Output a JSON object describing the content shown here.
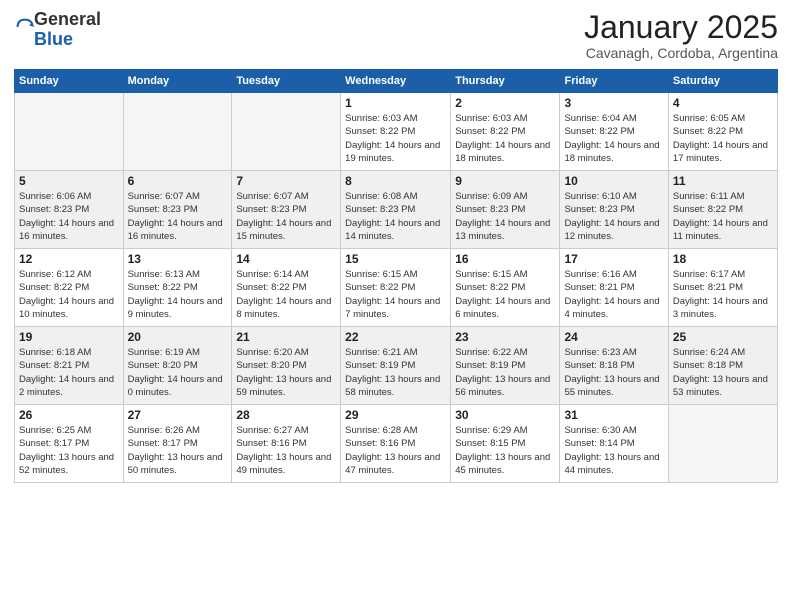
{
  "logo": {
    "general": "General",
    "blue": "Blue"
  },
  "title": "January 2025",
  "location": "Cavanagh, Cordoba, Argentina",
  "weekdays": [
    "Sunday",
    "Monday",
    "Tuesday",
    "Wednesday",
    "Thursday",
    "Friday",
    "Saturday"
  ],
  "weeks": [
    [
      {
        "day": "",
        "info": ""
      },
      {
        "day": "",
        "info": ""
      },
      {
        "day": "",
        "info": ""
      },
      {
        "day": "1",
        "info": "Sunrise: 6:03 AM\nSunset: 8:22 PM\nDaylight: 14 hours and 19 minutes."
      },
      {
        "day": "2",
        "info": "Sunrise: 6:03 AM\nSunset: 8:22 PM\nDaylight: 14 hours and 18 minutes."
      },
      {
        "day": "3",
        "info": "Sunrise: 6:04 AM\nSunset: 8:22 PM\nDaylight: 14 hours and 18 minutes."
      },
      {
        "day": "4",
        "info": "Sunrise: 6:05 AM\nSunset: 8:22 PM\nDaylight: 14 hours and 17 minutes."
      }
    ],
    [
      {
        "day": "5",
        "info": "Sunrise: 6:06 AM\nSunset: 8:23 PM\nDaylight: 14 hours and 16 minutes."
      },
      {
        "day": "6",
        "info": "Sunrise: 6:07 AM\nSunset: 8:23 PM\nDaylight: 14 hours and 16 minutes."
      },
      {
        "day": "7",
        "info": "Sunrise: 6:07 AM\nSunset: 8:23 PM\nDaylight: 14 hours and 15 minutes."
      },
      {
        "day": "8",
        "info": "Sunrise: 6:08 AM\nSunset: 8:23 PM\nDaylight: 14 hours and 14 minutes."
      },
      {
        "day": "9",
        "info": "Sunrise: 6:09 AM\nSunset: 8:23 PM\nDaylight: 14 hours and 13 minutes."
      },
      {
        "day": "10",
        "info": "Sunrise: 6:10 AM\nSunset: 8:23 PM\nDaylight: 14 hours and 12 minutes."
      },
      {
        "day": "11",
        "info": "Sunrise: 6:11 AM\nSunset: 8:22 PM\nDaylight: 14 hours and 11 minutes."
      }
    ],
    [
      {
        "day": "12",
        "info": "Sunrise: 6:12 AM\nSunset: 8:22 PM\nDaylight: 14 hours and 10 minutes."
      },
      {
        "day": "13",
        "info": "Sunrise: 6:13 AM\nSunset: 8:22 PM\nDaylight: 14 hours and 9 minutes."
      },
      {
        "day": "14",
        "info": "Sunrise: 6:14 AM\nSunset: 8:22 PM\nDaylight: 14 hours and 8 minutes."
      },
      {
        "day": "15",
        "info": "Sunrise: 6:15 AM\nSunset: 8:22 PM\nDaylight: 14 hours and 7 minutes."
      },
      {
        "day": "16",
        "info": "Sunrise: 6:15 AM\nSunset: 8:22 PM\nDaylight: 14 hours and 6 minutes."
      },
      {
        "day": "17",
        "info": "Sunrise: 6:16 AM\nSunset: 8:21 PM\nDaylight: 14 hours and 4 minutes."
      },
      {
        "day": "18",
        "info": "Sunrise: 6:17 AM\nSunset: 8:21 PM\nDaylight: 14 hours and 3 minutes."
      }
    ],
    [
      {
        "day": "19",
        "info": "Sunrise: 6:18 AM\nSunset: 8:21 PM\nDaylight: 14 hours and 2 minutes."
      },
      {
        "day": "20",
        "info": "Sunrise: 6:19 AM\nSunset: 8:20 PM\nDaylight: 14 hours and 0 minutes."
      },
      {
        "day": "21",
        "info": "Sunrise: 6:20 AM\nSunset: 8:20 PM\nDaylight: 13 hours and 59 minutes."
      },
      {
        "day": "22",
        "info": "Sunrise: 6:21 AM\nSunset: 8:19 PM\nDaylight: 13 hours and 58 minutes."
      },
      {
        "day": "23",
        "info": "Sunrise: 6:22 AM\nSunset: 8:19 PM\nDaylight: 13 hours and 56 minutes."
      },
      {
        "day": "24",
        "info": "Sunrise: 6:23 AM\nSunset: 8:18 PM\nDaylight: 13 hours and 55 minutes."
      },
      {
        "day": "25",
        "info": "Sunrise: 6:24 AM\nSunset: 8:18 PM\nDaylight: 13 hours and 53 minutes."
      }
    ],
    [
      {
        "day": "26",
        "info": "Sunrise: 6:25 AM\nSunset: 8:17 PM\nDaylight: 13 hours and 52 minutes."
      },
      {
        "day": "27",
        "info": "Sunrise: 6:26 AM\nSunset: 8:17 PM\nDaylight: 13 hours and 50 minutes."
      },
      {
        "day": "28",
        "info": "Sunrise: 6:27 AM\nSunset: 8:16 PM\nDaylight: 13 hours and 49 minutes."
      },
      {
        "day": "29",
        "info": "Sunrise: 6:28 AM\nSunset: 8:16 PM\nDaylight: 13 hours and 47 minutes."
      },
      {
        "day": "30",
        "info": "Sunrise: 6:29 AM\nSunset: 8:15 PM\nDaylight: 13 hours and 45 minutes."
      },
      {
        "day": "31",
        "info": "Sunrise: 6:30 AM\nSunset: 8:14 PM\nDaylight: 13 hours and 44 minutes."
      },
      {
        "day": "",
        "info": ""
      }
    ]
  ]
}
